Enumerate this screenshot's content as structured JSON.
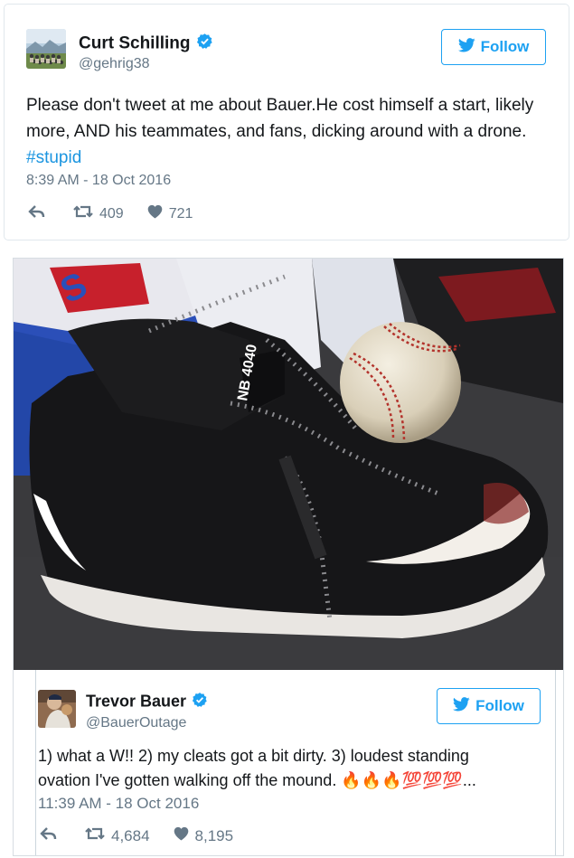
{
  "tweet1": {
    "name": "Curt Schilling",
    "handle": "@gehrig38",
    "follow_label": "Follow",
    "text_main": "Please don't tweet at me about Bauer.He cost himself a start, likely more, AND his teammates, and fans, dicking around with a drone.",
    "hashtag": "#stupid",
    "timestamp": "8:39 AM - 18 Oct 2016",
    "retweets": "409",
    "likes": "721"
  },
  "tweet2": {
    "name": "Trevor Bauer",
    "handle": "@BauerOutage",
    "follow_label": "Follow",
    "text_line1": "1) what a W!! 2) my cleats got a bit dirty. 3) loudest standing",
    "text_line2": "ovation I've gotten walking off the mound.",
    "emoji_fire": "🔥🔥🔥",
    "emoji_100": "💯💯💯",
    "ellipsis": "...",
    "timestamp": "11:39 AM - 18 Oct 2016",
    "retweets": "4,684",
    "likes": "8,195"
  },
  "photo": {
    "shoe_label": "NB 4040",
    "description_icons": [
      "cleats",
      "baseball"
    ]
  },
  "colors": {
    "twitter_blue": "#1da1f2",
    "verified_blue": "#1da1f2",
    "secondary_text": "#657786",
    "hashtag": "#1b95e0"
  }
}
